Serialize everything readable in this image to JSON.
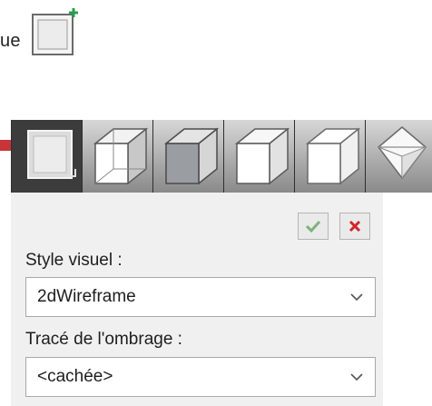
{
  "intro": {
    "text_fragment": "ue"
  },
  "toolbar": {
    "tools": [
      {
        "name": "2D wireframe"
      },
      {
        "name": "Wireframe"
      },
      {
        "name": "Shaded"
      },
      {
        "name": "Hidden"
      },
      {
        "name": "Conceptual"
      },
      {
        "name": "Realistic"
      }
    ]
  },
  "panel": {
    "visual_style_label": "Style visuel :",
    "visual_style_value": "2dWireframe",
    "shadow_label": "Tracé de l'ombrage :",
    "shadow_value": "<cachée>"
  },
  "colors": {
    "accent_green": "#22a14a",
    "cancel_red": "#d2262b",
    "arrow_red": "#c9343a"
  }
}
